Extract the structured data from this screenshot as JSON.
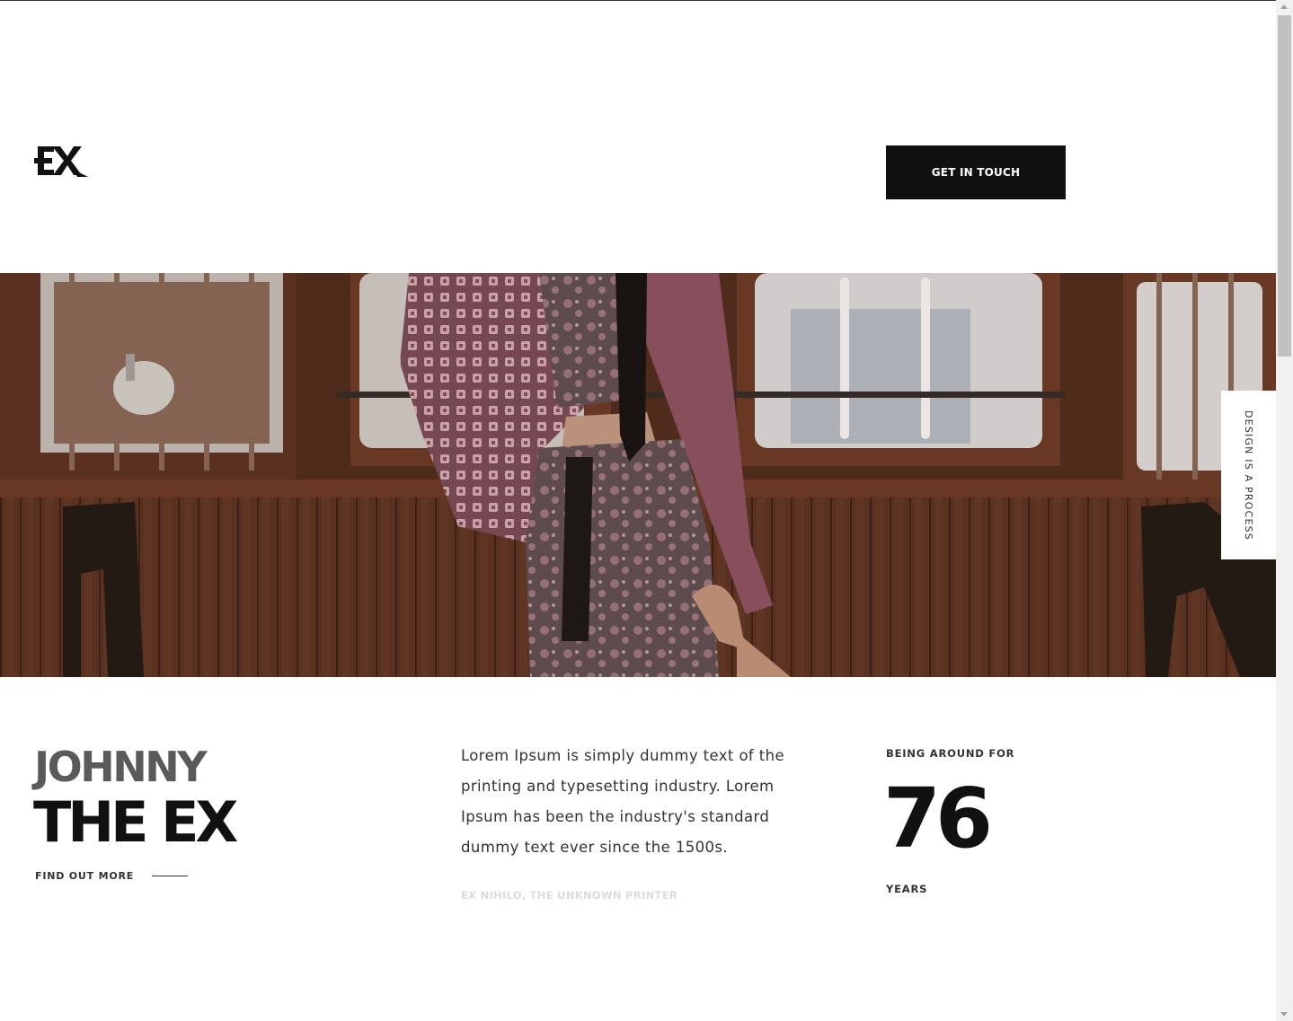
{
  "header": {
    "logo_text": "EX",
    "cta_label": "GET IN TOUCH"
  },
  "hero": {
    "image_alt": "Woman in floral kimono standing by wooden train windows",
    "side_tab_label": "DESIGN IS A PROCESS"
  },
  "intro": {
    "title_line1": "JOHNNY",
    "title_line2": "THE EX",
    "link_label": "FIND OUT MORE"
  },
  "quote": {
    "text": "Lorem Ipsum is simply dummy text of the printing and typesetting industry. Lorem Ipsum has been the industry's standard dummy text ever since the 1500s.",
    "author": "EX NIHILO, THE UNKNOWN PRINTER"
  },
  "stats": {
    "label_top": "BEING AROUND FOR",
    "value": "76",
    "label_bottom": "YEARS"
  },
  "colors": {
    "text_dark": "#111111",
    "title_grey": "#5a5a5a",
    "muted": "#dcdcdc"
  }
}
